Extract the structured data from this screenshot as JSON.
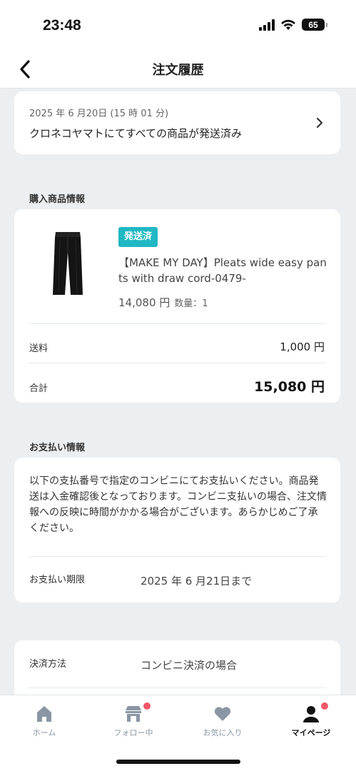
{
  "status_bar": {
    "time": "23:48",
    "battery": "65"
  },
  "header": {
    "title": "注文履歴"
  },
  "shipping": {
    "date": "2025 年 6 月20日 (15 時 01 分)",
    "status": "クロネコヤマトにてすべての商品が発送済み"
  },
  "purchase_section": {
    "label": "購入商品情報",
    "product": {
      "badge": "発送済",
      "name": "【MAKE MY DAY】Pleats wide easy pants with draw cord-0479-",
      "price": "14,080 円",
      "quantity": "数量：1"
    },
    "shipping_fee_label": "送料",
    "shipping_fee_value": "1,000 円",
    "total_label": "合計",
    "total_value": "15,080 円"
  },
  "payment_section": {
    "label": "お支払い情報",
    "note": "以下の支払番号で指定のコンビニにてお支払いください。商品発送は入金確認後となっております。コンビニ支払いの場合、注文情報への反映に時間がかかる場合がございます。あらかじめご了承ください。",
    "deadline_label": "お支払い期限",
    "deadline_value": "2025 年 6 月21日まで"
  },
  "method_section": {
    "label": "決済方法",
    "value": "コンビニ決済の場合"
  },
  "tab_bar": {
    "items": [
      {
        "label": "ホーム",
        "icon": "home-icon"
      },
      {
        "label": "フォロー中",
        "icon": "shop-icon"
      },
      {
        "label": "お気に入り",
        "icon": "heart-icon"
      },
      {
        "label": "マイページ",
        "icon": "person-icon"
      }
    ]
  },
  "colors": {
    "accent_badge": "#1fb8c3",
    "notification_dot": "#f0566a",
    "background": "#eceff1"
  }
}
